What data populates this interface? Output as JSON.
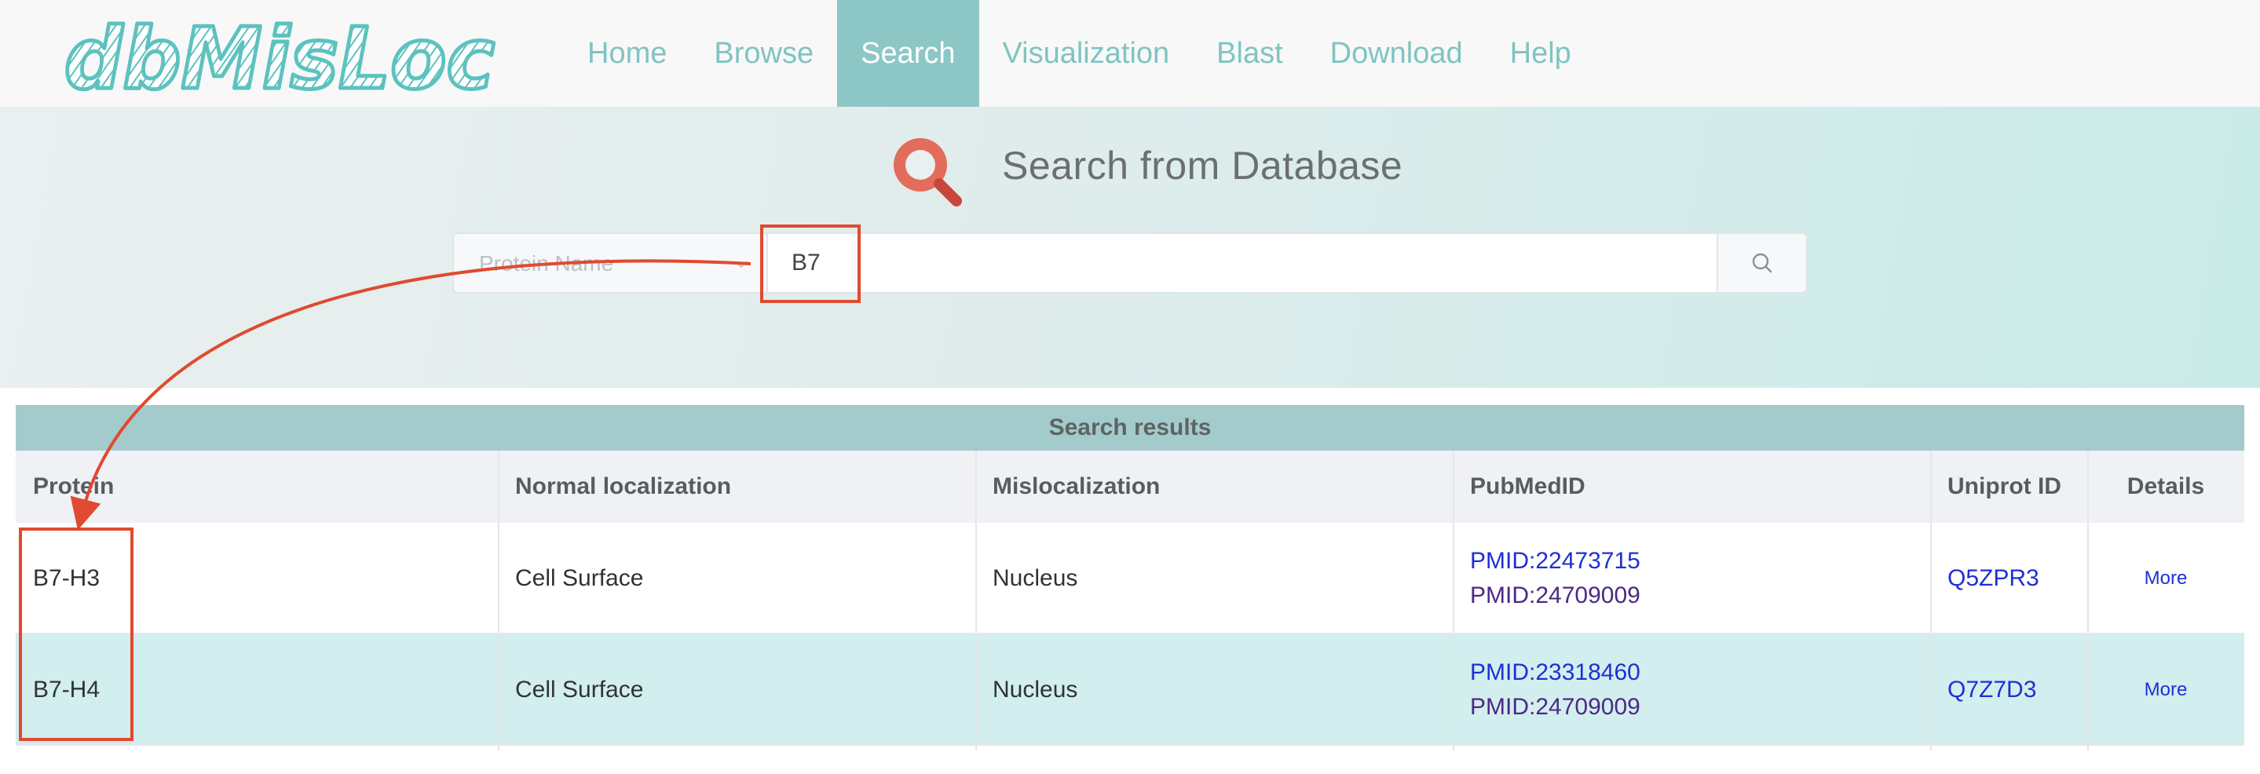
{
  "brand": {
    "logo_text": "dbMisLoc",
    "logo_color": "#5cc2bf"
  },
  "nav": {
    "items": [
      {
        "label": "Home"
      },
      {
        "label": "Browse"
      },
      {
        "label": "Search"
      },
      {
        "label": "Visualization"
      },
      {
        "label": "Blast"
      },
      {
        "label": "Download"
      },
      {
        "label": "Help"
      }
    ],
    "active": "Search",
    "accent": "#8cc7c5"
  },
  "search": {
    "title": "Search from Database",
    "field_select": {
      "placeholder": "Protein Name",
      "icon": "chevron-down-icon"
    },
    "query_value": "B7",
    "submit_icon": "search-icon",
    "hero_icon": "magnifier-icon",
    "hero_icon_color": "#e36d5c"
  },
  "results": {
    "title": "Search results",
    "columns": [
      "Protein",
      "Normal localization",
      "Mislocalization",
      "PubMedID",
      "Uniprot ID",
      "Details"
    ],
    "rows": [
      {
        "protein": "B7-H3",
        "normal_localization": "Cell Surface",
        "mislocalization": "Nucleus",
        "pubmed_ids": [
          "PMID:22473715",
          "PMID:24709009"
        ],
        "uniprot_id": "Q5ZPR3",
        "details": "More"
      },
      {
        "protein": "B7-H4",
        "normal_localization": "Cell Surface",
        "mislocalization": "Nucleus",
        "pubmed_ids": [
          "PMID:23318460",
          "PMID:24709009"
        ],
        "uniprot_id": "Q7Z7D3",
        "details": "More"
      }
    ]
  },
  "annotation": {
    "color": "#e04a2f"
  }
}
